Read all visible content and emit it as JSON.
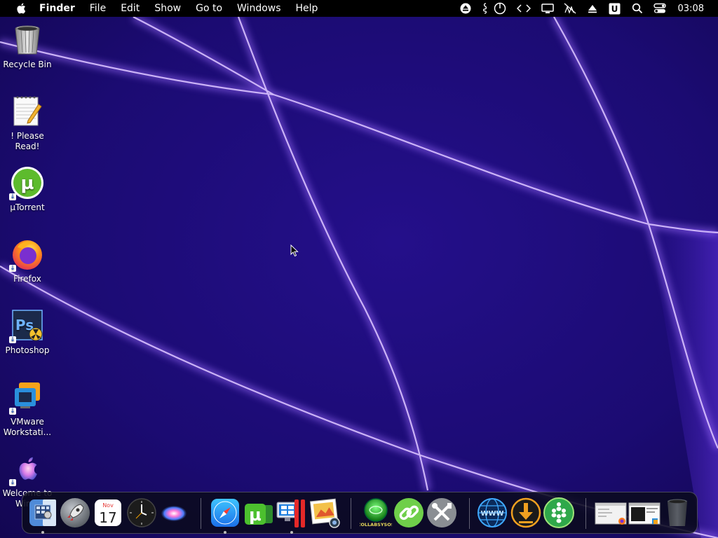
{
  "menubar": {
    "app_name": "Finder",
    "menus": [
      "File",
      "Edit",
      "Show",
      "Go to",
      "Windows",
      "Help"
    ],
    "clock": "03:08",
    "status_icons": [
      "eject-icon",
      "script-icon",
      "power-icon",
      "code-brackets-icon",
      "display-icon",
      "mute-icon",
      "airdrop-icon",
      "u-icon",
      "search-icon",
      "control-center-icon"
    ]
  },
  "desktop": {
    "icons": [
      {
        "label": "Recycle Bin",
        "icon": "recycle-bin-icon"
      },
      {
        "label": "! Please Read!",
        "icon": "notepad-icon"
      },
      {
        "label": "µTorrent",
        "icon": "utorrent-icon"
      },
      {
        "label": "Firefox",
        "icon": "firefox-icon"
      },
      {
        "label": "Photoshop",
        "icon": "photoshop-icon"
      },
      {
        "label": "VMware Workstati...",
        "icon": "vmware-icon"
      },
      {
        "label": "Welcome to Win...",
        "icon": "apple-welcome-icon"
      }
    ]
  },
  "dock": {
    "apps": [
      {
        "name": "finder",
        "icon": "finder-icon",
        "running": true
      },
      {
        "name": "launchpad",
        "icon": "rocket-icon",
        "running": false
      },
      {
        "name": "calendar",
        "icon": "calendar-icon",
        "running": false,
        "month": "Nov",
        "day": "17"
      },
      {
        "name": "clock",
        "icon": "clock-icon",
        "running": false
      },
      {
        "name": "siri",
        "icon": "siri-icon",
        "running": false
      },
      {
        "name": "safari",
        "icon": "safari-icon",
        "running": true
      },
      {
        "name": "utorrent",
        "icon": "utorrent-icon",
        "running": false
      },
      {
        "name": "boot-camp",
        "icon": "parallels-icon",
        "running": true
      },
      {
        "name": "preview",
        "icon": "preview-icon",
        "running": false
      },
      {
        "name": "collabsysos",
        "icon": "collabsysos-icon",
        "running": false,
        "caption": "COLLABSYSOS"
      },
      {
        "name": "link",
        "icon": "link-icon",
        "running": false
      },
      {
        "name": "tools",
        "icon": "tools-icon",
        "running": false
      },
      {
        "name": "www",
        "icon": "globe-www-icon",
        "running": false,
        "caption": "WWW"
      },
      {
        "name": "downloads",
        "icon": "download-icon",
        "running": false
      },
      {
        "name": "people",
        "icon": "people-icon",
        "running": false
      },
      {
        "name": "window-thumb-1",
        "icon": "window-thumbnail-icon",
        "running": false
      },
      {
        "name": "window-thumb-2",
        "icon": "window-thumbnail-icon",
        "running": false
      },
      {
        "name": "trash",
        "icon": "trash-icon",
        "running": false
      }
    ]
  },
  "colors": {
    "wallpaper_base": "#1a0b6e",
    "wallpaper_line": "#b58cff",
    "menubar_bg": "#000000"
  }
}
